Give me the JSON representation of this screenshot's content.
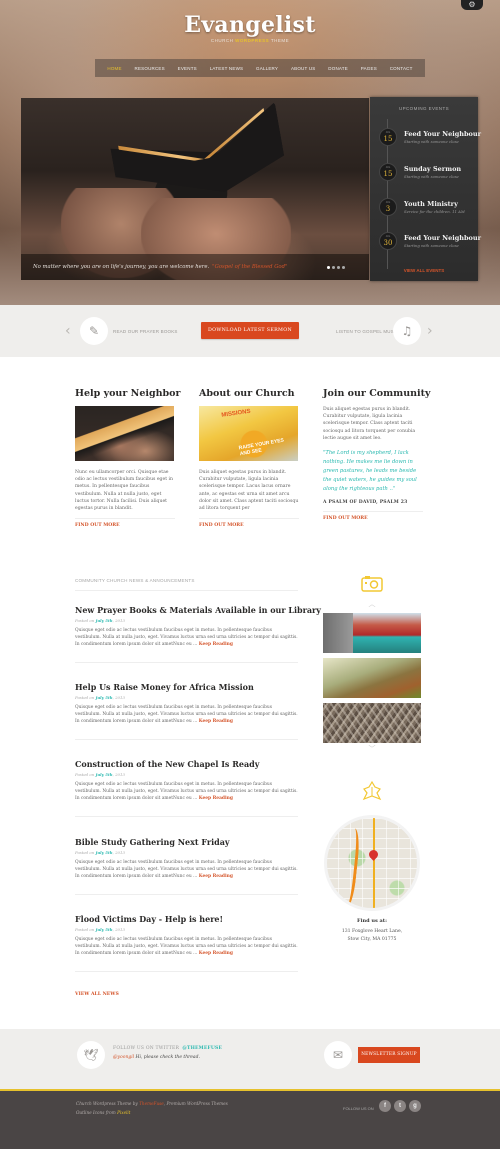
{
  "header": {
    "logo": "Evangelist",
    "tagline_pre": "CHURCH ",
    "tagline_highlight": "WORDPRESS",
    "tagline_post": " THEME",
    "settings_icon": "gear-icon",
    "nav": [
      "HOME",
      "RESOURCES",
      "EVENTS",
      "LATEST NEWS",
      "GALLERY",
      "ABOUT US",
      "DONATE",
      "PAGES",
      "CONTACT"
    ],
    "nav_active": 0
  },
  "slider": {
    "caption": "No matter where you are on life's journey, you are welcome here.",
    "caption_highlight": "\"Gospel of the Blessed God\"",
    "slides_count": 4,
    "active_slide": 1
  },
  "events": {
    "heading": "UPCOMING EVENTS",
    "items": [
      {
        "month": "JUL",
        "day": "15",
        "title": "Feed Your Neighbour",
        "subtitle": "Starting with someone close"
      },
      {
        "month": "JUL",
        "day": "15",
        "title": "Sunday Sermon",
        "subtitle": "Starting with someone close"
      },
      {
        "month": "JUL",
        "day": "3",
        "title": "Youth Ministry",
        "subtitle": "Service for the children. 11 AM"
      },
      {
        "month": "JUL",
        "day": "30",
        "title": "Feed Your Neighbour",
        "subtitle": "Starting with someone close"
      }
    ],
    "view_all": "VIEW ALL EVENTS"
  },
  "action_bar": {
    "left_label": "READ OUR PRAYER BOOKS",
    "button": "DOWNLOAD LATEST SERMON",
    "right_label": "LISTEN TO GOSPEL MUSIC",
    "prev": "‹",
    "next": "›"
  },
  "features": {
    "help": {
      "title": "Help your Neighbor",
      "text": "Nunc eu ullamcorper orci. Quisque etae odio ac lectus vestibulum faucibus eget in metus. In pellentesque faucibus vestibulum. Nulla at nulla justo, eget luctus tortor. Nulla facilisi. Duis aliquet egestas purus in blandit.",
      "more": "FIND OUT MORE"
    },
    "about": {
      "title": "About our Church",
      "image_text_top": "MISSIONS",
      "image_text_bottom": "RAISE YOUR EYES AND SEE",
      "text": "Duis aliquet egestas purus in blandit. Curabitur vulputate, ligula lacinia scelerisque tempor. Lacus lacus ornare ante, ac egestas est urna sit amet arcu dolor sit amet. Class aptent taciti sociosqu ad litora torquent per",
      "more": "FIND OUT MORE"
    },
    "join": {
      "title": "Join our Community",
      "text": "Duis aliquet egestas purus in blandit. Curabitur vulputate, ligula lacinia scelerisque tempor. Class aptent taciti sociosqu ad litora torquent per conubia lectie augue sit amet leo.",
      "quote": "\"The Lord is my shepherd, I lack nothing. He makes me lie down in green pastures, he leads me beside the quiet waters, he guides my soul along the righteous path ..\"",
      "cite": "A PSALM OF DAVID, PSALM 23",
      "more": "FIND OUT MORE"
    }
  },
  "news": {
    "heading": "COMMUNITY CHURCH NEWS & ANNOUNCEMENTS",
    "posts": [
      {
        "title": "New Prayer Books & Materials Available in our Library",
        "posted": "Posted on",
        "date": "July 5th",
        "year": ", 2013",
        "excerpt": "Quisque eget odio ac lectus vestibulum faucibus eget in metus. In pellentesque faucibus vestibulum. Nulla at nulla justo, eget. Vivamus luctus urna sed urna ultricies ac tempor dui sagittis. In condimentum lorem ipsum dolor sit ametNunc eu ...",
        "read_more": "Keep Reading"
      },
      {
        "title": "Help Us Raise Money for Africa Mission",
        "posted": "Posted on",
        "date": "July 5th",
        "year": ", 2013",
        "excerpt": "Quisque eget odio ac lectus vestibulum faucibus eget in metus. In pellentesque faucibus vestibulum. Nulla at nulla justo, eget. Vivamus luctus urna sed urna ultricies ac tempor dui sagittis. In condimentum lorem ipsum dolor sit ametNunc eu ...",
        "read_more": "Keep Reading"
      },
      {
        "title": "Construction of the New Chapel Is Ready",
        "posted": "Posted on",
        "date": "July 5th",
        "year": ", 2013",
        "excerpt": "Quisque eget odio ac lectus vestibulum faucibus eget in metus. In pellentesque faucibus vestibulum. Nulla at nulla justo, eget. Vivamus luctus urna sed urna ultricies ac tempor dui sagittis. In condimentum lorem ipsum dolor sit ametNunc eu ...",
        "read_more": "Keep Reading"
      },
      {
        "title": "Bible Study Gathering Next Friday",
        "posted": "Posted on",
        "date": "July 5th",
        "year": ", 2013",
        "excerpt": "Quisque eget odio ac lectus vestibulum faucibus eget in metus. In pellentesque faucibus vestibulum. Nulla at nulla justo, eget. Vivamus luctus urna sed urna ultricies ac tempor dui sagittis. In condimentum lorem ipsum dolor sit ametNunc eu ...",
        "read_more": "Keep Reading"
      },
      {
        "title": "Flood Victims Day - Help is here!",
        "posted": "Posted on",
        "date": "July 5th",
        "year": ", 2013",
        "excerpt": "Quisque eget odio ac lectus vestibulum faucibus eget in metus. In pellentesque faucibus vestibulum. Nulla at nulla justo, eget. Vivamus luctus urna sed urna ultricies ac tempor dui sagittis. In condimentum lorem ipsum dolor sit ametNunc eu ...",
        "read_more": "Keep Reading"
      }
    ],
    "view_all": "VIEW ALL NEWS"
  },
  "sidebar": {
    "gallery_icon": "camera-icon",
    "map_icon": "map-flower-icon",
    "find_title": "Find us at:",
    "address_line1": "131 Foxglove Heart Lane,",
    "address_line2": "Stow City, MA 01775"
  },
  "twitter": {
    "label": "FOLLOW US ON TWITTER",
    "handle": "@THEMEFUSE",
    "mention": "@yoongil",
    "tweet": " Hi, please check the thread.",
    "newsletter_button": "NEWSLETTER SIGNUP"
  },
  "footer": {
    "credit_pre": "Church Wordpress Theme by ",
    "credit_brand": "ThemeFuse",
    "credit_post": ", Premium WordPress Themes",
    "icons_pre": "Outline Icons from ",
    "icons_brand": "Pixelit",
    "follow_label": "FOLLOW US ON",
    "social": [
      "f",
      "t",
      "g"
    ]
  },
  "colors": {
    "accent_orange": "#d9481f",
    "accent_teal": "#2ab9b0",
    "accent_yellow": "#e6c12d",
    "footer_bg": "#4a4545"
  }
}
